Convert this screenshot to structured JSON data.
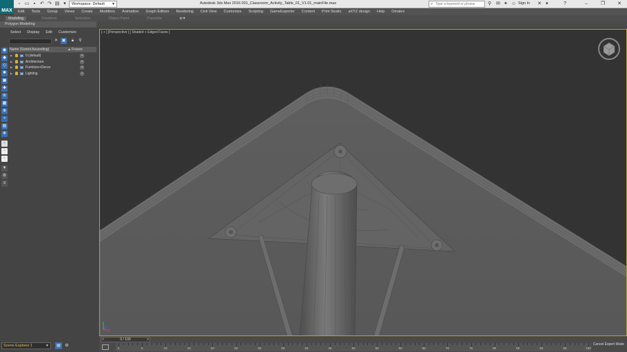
{
  "titlebar": {
    "logo": "MAX",
    "workspace": "Workspace: Default",
    "title": "Autodesk 3ds Max 2016      001_Classroom_Activity_Table_01_V1.01_mainFile.max",
    "search_placeholder": "Type a keyword or phrase",
    "signin": "Sign In"
  },
  "menubar": [
    "Edit",
    "Tools",
    "Group",
    "Views",
    "Create",
    "Modifiers",
    "Animation",
    "Graph Editors",
    "Rendering",
    "Civil View",
    "Customize",
    "Scripting",
    "GameExporter",
    "Content",
    "Print Studio",
    "aXYZ design",
    "Help",
    "Omalex"
  ],
  "ribbon": {
    "tabs": [
      "Modeling",
      "Freeform",
      "Selection",
      "Object Paint",
      "Populate"
    ],
    "active_tab": "Modeling",
    "sub_label": "Polygon Modeling"
  },
  "explorer": {
    "menu": [
      "Select",
      "Display",
      "Edit",
      "Customize"
    ],
    "columns": {
      "name": "Name (Sorted Ascending)",
      "sort_arrow": "▲",
      "frozen": "Frozen"
    },
    "rows": [
      {
        "name": "0 (default)"
      },
      {
        "name": "Architecture"
      },
      {
        "name": "Furniture+Decor"
      },
      {
        "name": "Lighting"
      }
    ]
  },
  "viewport": {
    "label": "[ + ] [Perspective ] [ Shaded + Edged Faces ]",
    "border_color": "#b8a23a",
    "background": "#333333"
  },
  "bottom": {
    "scene_explorer": "Scene Explorer 1",
    "time_slider": "0 / 100",
    "cancel_expert": "Cancel Expert Mode",
    "ticks": [
      "0",
      "5",
      "10",
      "15",
      "20",
      "25",
      "30",
      "35",
      "40",
      "45",
      "50",
      "55",
      "60",
      "65",
      "70",
      "75",
      "80",
      "85",
      "90",
      "95",
      "100"
    ]
  }
}
